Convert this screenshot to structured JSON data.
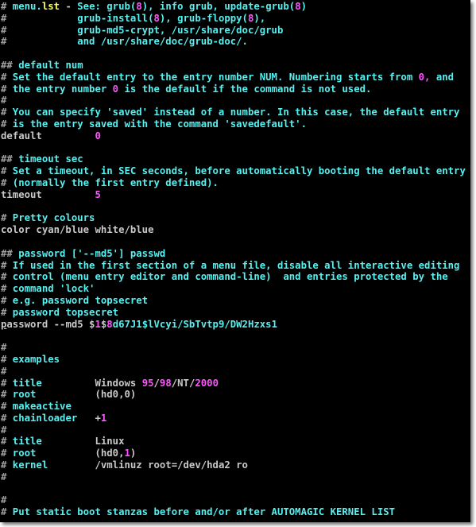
{
  "colors": {
    "comment_hash": "#a0a0a0",
    "text_cyan": "#55f0f0",
    "number_magenta": "#ff55ff",
    "highlight_yellow": "#ffff55",
    "value_gray": "#c8c8c8",
    "background": "#000000"
  },
  "cursor": {
    "line": 27,
    "column": 0
  },
  "lines": [
    [
      [
        "#",
        "h"
      ],
      [
        " menu.",
        "c"
      ],
      [
        "lst",
        "y"
      ],
      [
        " - ",
        "g"
      ],
      [
        "See: grub(",
        "c"
      ],
      [
        "8",
        "m"
      ],
      [
        "), info grub, update-grub(",
        "c"
      ],
      [
        "8",
        "m"
      ],
      [
        ")",
        "c"
      ]
    ],
    [
      [
        "#",
        "h"
      ],
      [
        "            grub-install(",
        "c"
      ],
      [
        "8",
        "m"
      ],
      [
        "), grub-floppy(",
        "c"
      ],
      [
        "8",
        "m"
      ],
      [
        "),",
        "c"
      ]
    ],
    [
      [
        "#",
        "h"
      ],
      [
        "            grub-md5-crypt, /usr/share/doc/grub",
        "c"
      ]
    ],
    [
      [
        "#",
        "h"
      ],
      [
        "            and /usr/share/doc/grub-doc/.",
        "c"
      ]
    ],
    [],
    [
      [
        "##",
        "h"
      ],
      [
        " default num",
        "c"
      ]
    ],
    [
      [
        "#",
        "h"
      ],
      [
        " Set the default entry to the entry number NUM. Numbering starts from ",
        "c"
      ],
      [
        "0,",
        "m"
      ],
      [
        " and",
        "c"
      ]
    ],
    [
      [
        "#",
        "h"
      ],
      [
        " the entry number ",
        "c"
      ],
      [
        "0",
        "m"
      ],
      [
        " is the default if the command is not used.",
        "c"
      ]
    ],
    [
      [
        "#",
        "h"
      ]
    ],
    [
      [
        "#",
        "h"
      ],
      [
        " You can specify 'saved' instead of a number. In this case, the default entry",
        "c"
      ]
    ],
    [
      [
        "#",
        "h"
      ],
      [
        " is the entry saved with the command 'savedefault'.",
        "c"
      ]
    ],
    [
      [
        "default         ",
        "g"
      ],
      [
        "0",
        "m"
      ]
    ],
    [],
    [
      [
        "##",
        "h"
      ],
      [
        " timeout sec",
        "c"
      ]
    ],
    [
      [
        "#",
        "h"
      ],
      [
        " Set a timeout, in SEC seconds, before automatically booting the default entry",
        "c"
      ]
    ],
    [
      [
        "#",
        "h"
      ],
      [
        " (normally the first entry defined).",
        "c"
      ]
    ],
    [
      [
        "timeout         ",
        "g"
      ],
      [
        "5",
        "m"
      ]
    ],
    [],
    [
      [
        "#",
        "h"
      ],
      [
        " Pretty colours",
        "c"
      ]
    ],
    [
      [
        "color cyan/blue white/blue",
        "g"
      ]
    ],
    [],
    [
      [
        "##",
        "h"
      ],
      [
        " password ['--md5'] passwd",
        "c"
      ]
    ],
    [
      [
        "#",
        "h"
      ],
      [
        " If used in the first section of a menu file, disable all interactive editing",
        "c"
      ]
    ],
    [
      [
        "#",
        "h"
      ],
      [
        " control (menu entry editor and command-line)  and entries protected by the",
        "c"
      ]
    ],
    [
      [
        "#",
        "h"
      ],
      [
        " command 'lock'",
        "c"
      ]
    ],
    [
      [
        "#",
        "h"
      ],
      [
        " e.g. password topsecret",
        "c"
      ]
    ],
    [
      [
        "#",
        "h"
      ],
      [
        " password topsecret",
        "c"
      ]
    ],
    [
      [
        "p",
        "g cursor"
      ],
      [
        "assword --md5 $",
        "g"
      ],
      [
        "1",
        "m"
      ],
      [
        "$",
        "g"
      ],
      [
        "8",
        "m"
      ],
      [
        "d67J1$lVcyi/SbTvtp9/DW2Hzxs1",
        "c"
      ]
    ],
    [],
    [
      [
        "#",
        "h"
      ]
    ],
    [
      [
        "#",
        "h"
      ],
      [
        " examples",
        "c"
      ]
    ],
    [
      [
        "#",
        "h"
      ]
    ],
    [
      [
        "#",
        "h"
      ],
      [
        " title         ",
        "c"
      ],
      [
        "Windows ",
        "g"
      ],
      [
        "95",
        "m"
      ],
      [
        "/",
        "g"
      ],
      [
        "98",
        "m"
      ],
      [
        "/NT/",
        "g"
      ],
      [
        "2000",
        "m"
      ]
    ],
    [
      [
        "#",
        "h"
      ],
      [
        " root          ",
        "c"
      ],
      [
        "(hd0,0)",
        "g"
      ]
    ],
    [
      [
        "#",
        "h"
      ],
      [
        " makeactive",
        "c"
      ]
    ],
    [
      [
        "#",
        "h"
      ],
      [
        " chainloader   ",
        "c"
      ],
      [
        "+",
        "g"
      ],
      [
        "1",
        "m"
      ]
    ],
    [
      [
        "#",
        "h"
      ]
    ],
    [
      [
        "#",
        "h"
      ],
      [
        " title         ",
        "c"
      ],
      [
        "Linux",
        "g"
      ]
    ],
    [
      [
        "#",
        "h"
      ],
      [
        " root          ",
        "c"
      ],
      [
        "(hd0,",
        "g"
      ],
      [
        "1",
        "m"
      ],
      [
        ")",
        "g"
      ]
    ],
    [
      [
        "#",
        "h"
      ],
      [
        " kernel        ",
        "c"
      ],
      [
        "/vmlinuz root=/dev/hda2 ro",
        "g"
      ]
    ],
    [
      [
        "#",
        "h"
      ]
    ],
    [],
    [
      [
        "#",
        "h"
      ]
    ],
    [
      [
        "#",
        "h"
      ],
      [
        " Put static boot stanzas before and/or after AUTOMAGIC KERNEL LIST",
        "c"
      ]
    ]
  ]
}
